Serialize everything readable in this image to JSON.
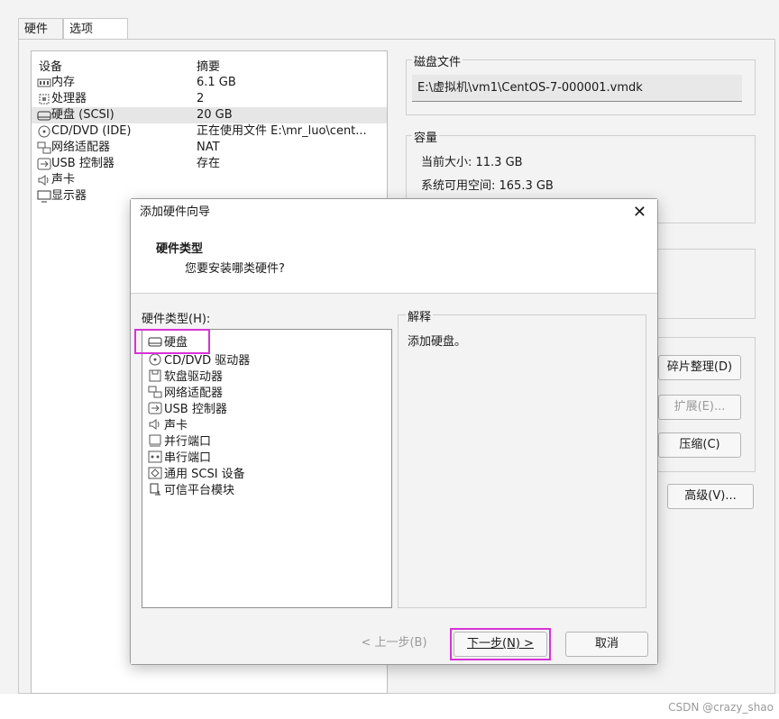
{
  "tabs": [
    "硬件",
    "选项"
  ],
  "device_list": {
    "headers": [
      "设备",
      "摘要"
    ],
    "rows": [
      {
        "name": "内存",
        "summary": "6.1 GB",
        "icon": "memory-icon"
      },
      {
        "name": "处理器",
        "summary": "2",
        "icon": "cpu-icon"
      },
      {
        "name": "硬盘 (SCSI)",
        "summary": "20 GB",
        "icon": "harddisk-icon",
        "selected": true
      },
      {
        "name": "CD/DVD (IDE)",
        "summary": "正在使用文件 E:\\mr_luo\\cent...",
        "icon": "cd-icon"
      },
      {
        "name": "网络适配器",
        "summary": "NAT",
        "icon": "network-icon"
      },
      {
        "name": "USB 控制器",
        "summary": "存在",
        "icon": "usb-icon"
      },
      {
        "name": "声卡",
        "summary": "",
        "icon": "sound-icon"
      },
      {
        "name": "显示器",
        "summary": "",
        "icon": "monitor-icon"
      }
    ]
  },
  "disk_file": {
    "title": "磁盘文件",
    "path": "E:\\虚拟机\\vm1\\CentOS-7-000001.vmdk"
  },
  "capacity": {
    "title": "容量",
    "current": "当前大小: 11.3 GB",
    "available": "系统可用空间: 165.3 GB"
  },
  "side_buttons": {
    "defrag": "碎片整理(D)",
    "expand": "扩展(E)...",
    "compact": "压缩(C)",
    "advanced": "高级(V)..."
  },
  "dialog": {
    "title": "添加硬件向导",
    "close": "✕",
    "heading": "硬件类型",
    "subheading": "您要安装哪类硬件?",
    "hw_label": "硬件类型(H):",
    "hw_items": [
      {
        "label": "硬盘",
        "icon": "harddisk-icon"
      },
      {
        "label": "CD/DVD 驱动器",
        "icon": "cd-icon"
      },
      {
        "label": "软盘驱动器",
        "icon": "floppy-icon"
      },
      {
        "label": "网络适配器",
        "icon": "network-icon"
      },
      {
        "label": "USB 控制器",
        "icon": "usb-icon"
      },
      {
        "label": "声卡",
        "icon": "sound-icon"
      },
      {
        "label": "并行端口",
        "icon": "parallel-port-icon"
      },
      {
        "label": "串行端口",
        "icon": "serial-port-icon"
      },
      {
        "label": "通用 SCSI 设备",
        "icon": "scsi-icon"
      },
      {
        "label": "可信平台模块",
        "icon": "tpm-icon"
      }
    ],
    "explain_title": "解释",
    "explain_text": "添加硬盘。",
    "back": "< 上一步(B)",
    "next": "下一步(N) >",
    "cancel": "取消"
  },
  "watermark": "CSDN @crazy_shao",
  "colors": {
    "highlight": "#d633d6",
    "selected_row": "#e6e6e6"
  }
}
